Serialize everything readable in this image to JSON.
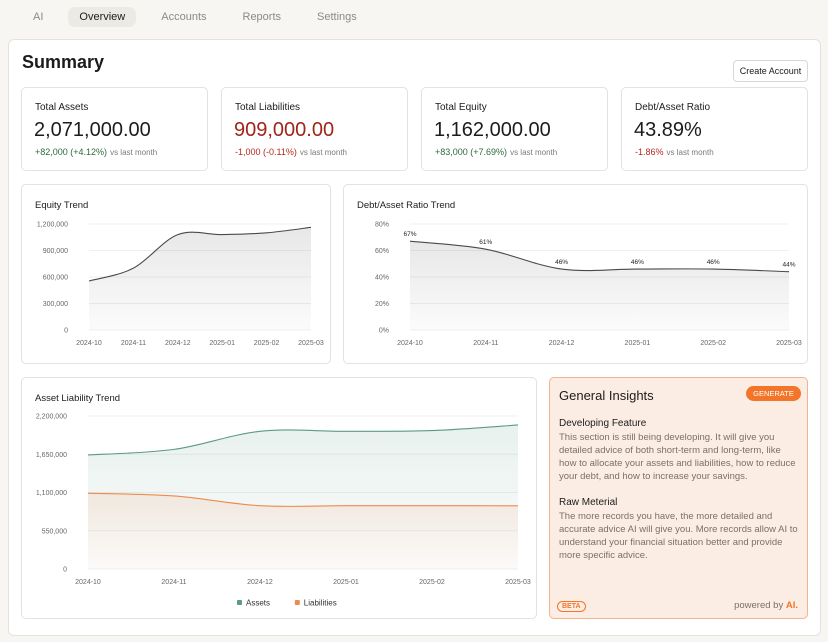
{
  "nav": {
    "tabs": [
      "AI",
      "Overview",
      "Accounts",
      "Reports",
      "Settings"
    ],
    "active": "Overview"
  },
  "page": {
    "title": "Summary",
    "create_label": "Create Account"
  },
  "stats": [
    {
      "label": "Total Assets",
      "value": "2,071,000.00",
      "change": "+82,000 (+4.12%)",
      "vs": "vs last month",
      "negative": false
    },
    {
      "label": "Total Liabilities",
      "value": "909,000.00",
      "change": "-1,000 (-0.11%)",
      "vs": "vs last month",
      "negative": true
    },
    {
      "label": "Total Equity",
      "value": "1,162,000.00",
      "change": "+83,000 (+7.69%)",
      "vs": "vs last month",
      "negative": false
    },
    {
      "label": "Debt/Asset Ratio",
      "value": "43.89%",
      "change": "-1.86%",
      "vs": "vs last month",
      "negative": true
    }
  ],
  "chart_data": [
    {
      "type": "line",
      "title": "Equity Trend",
      "x": [
        "2024-10",
        "2024-11",
        "2024-12",
        "2025-01",
        "2025-02",
        "2025-03"
      ],
      "series": [
        {
          "values": [
            555000,
            700000,
            1080000,
            1080000,
            1100000,
            1162000
          ]
        }
      ],
      "yticks": [
        "0",
        "300,000",
        "600,000",
        "900,000",
        "1,200,000"
      ],
      "ylim": [
        0,
        1200000
      ],
      "color": "#4a4a4a"
    },
    {
      "type": "line",
      "title": "Debt/Asset Ratio Trend",
      "x": [
        "2024-10",
        "2024-11",
        "2024-12",
        "2025-01",
        "2025-02",
        "2025-03"
      ],
      "series": [
        {
          "values": [
            67,
            61,
            46,
            46,
            46,
            44
          ],
          "labels": [
            "67%",
            "61%",
            "46%",
            "46%",
            "46%",
            "44%"
          ]
        }
      ],
      "yticks": [
        "0%",
        "20%",
        "40%",
        "60%",
        "80%"
      ],
      "ylim": [
        0,
        80
      ],
      "color": "#4a4a4a"
    },
    {
      "type": "area",
      "title": "Asset Liability Trend",
      "x": [
        "2024-10",
        "2024-11",
        "2024-12",
        "2025-01",
        "2025-02",
        "2025-03"
      ],
      "series": [
        {
          "name": "Assets",
          "values": [
            1640000,
            1720000,
            1980000,
            1980000,
            1990000,
            2071000
          ],
          "color": "#5a9a86"
        },
        {
          "name": "Liabilities",
          "values": [
            1090000,
            1050000,
            910000,
            910000,
            910000,
            909000
          ],
          "color": "#ef8a4e"
        }
      ],
      "yticks": [
        "0",
        "550,000",
        "1,100,000",
        "1,650,000",
        "2,200,000"
      ],
      "ylim": [
        0,
        2200000
      ]
    }
  ],
  "insights": {
    "title": "General Insights",
    "generate_label": "GENERATE",
    "sections": [
      {
        "title": "Developing Feature",
        "body": "This section is still being developing. It will give you detailed advice of both short-term and long-term, like how to allocate your assets and liabilities, how to reduce your debt, and how to increase your savings."
      },
      {
        "title": "Raw Meterial",
        "body": "The more records you have, the more detailed and accurate advice AI will give you. More records allow AI to understand your financial situation better and provide more specific advice."
      }
    ],
    "beta": "BETA",
    "powered_by": "powered by",
    "ai_mark": "AI."
  },
  "colors": {
    "accent": "#f27529",
    "positive": "#2d6a3a",
    "negative": "#b5291d"
  }
}
